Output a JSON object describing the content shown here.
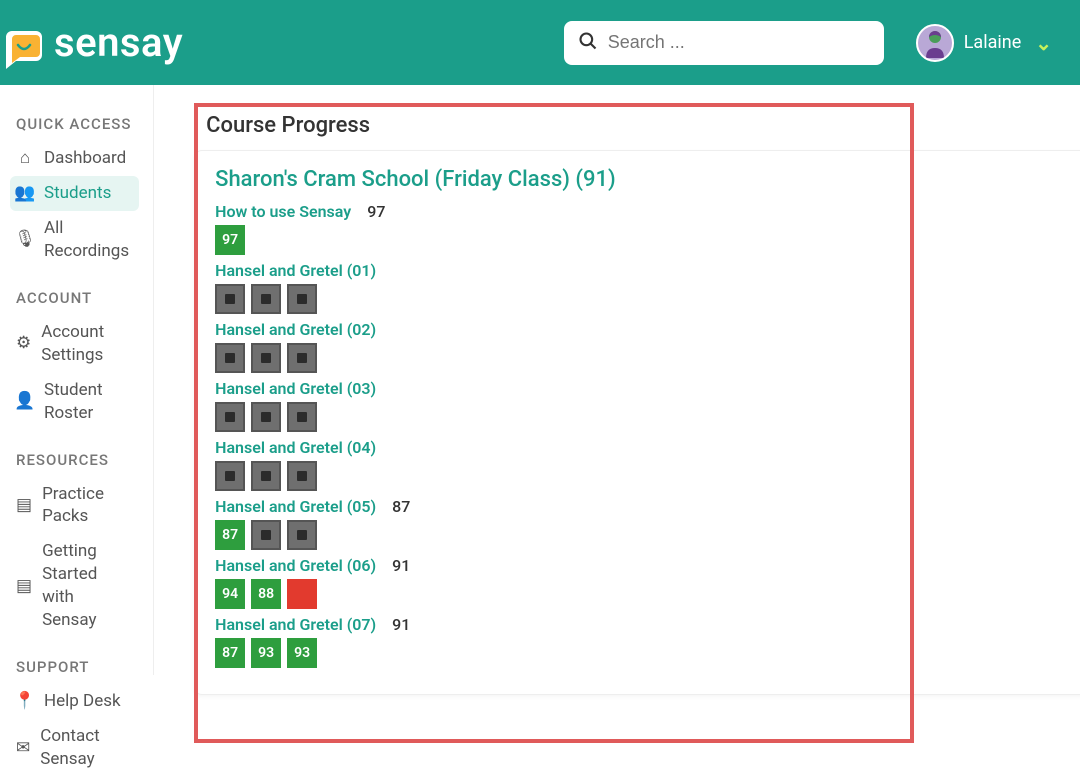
{
  "brand": {
    "name": "sensay"
  },
  "search": {
    "placeholder": "Search ..."
  },
  "user": {
    "name": "Lalaine"
  },
  "sidebar": {
    "sections": [
      {
        "title": "QUICK ACCESS",
        "items": [
          {
            "icon": "home",
            "label": "Dashboard",
            "name": "dashboard",
            "active": false
          },
          {
            "icon": "users",
            "label": "Students",
            "name": "students",
            "active": true
          },
          {
            "icon": "mic",
            "label": "All Recordings",
            "name": "all-recordings",
            "active": false
          }
        ]
      },
      {
        "title": "ACCOUNT",
        "items": [
          {
            "icon": "gear",
            "label": "Account Settings",
            "name": "account-settings"
          },
          {
            "icon": "roster",
            "label": "Student Roster",
            "name": "student-roster"
          }
        ]
      },
      {
        "title": "RESOURCES",
        "items": [
          {
            "icon": "book",
            "label": "Practice Packs",
            "name": "practice-packs"
          },
          {
            "icon": "book",
            "label": "Getting Started with Sensay",
            "name": "getting-started"
          }
        ]
      },
      {
        "title": "SUPPORT",
        "items": [
          {
            "icon": "pin",
            "label": "Help Desk",
            "name": "help-desk"
          },
          {
            "icon": "mail",
            "label": "Contact Sensay",
            "name": "contact-sensay"
          }
        ]
      }
    ]
  },
  "main": {
    "panel_title": "Course Progress",
    "class_title": "Sharon's Cram School (Friday Class) (91)",
    "lessons": [
      {
        "title": "How to use Sensay",
        "score": "97",
        "tiles": [
          {
            "kind": "green",
            "val": "97"
          }
        ]
      },
      {
        "title": "Hansel and Gretel (01)",
        "score": "",
        "tiles": [
          {
            "kind": "grey"
          },
          {
            "kind": "grey"
          },
          {
            "kind": "grey"
          }
        ]
      },
      {
        "title": "Hansel and Gretel (02)",
        "score": "",
        "tiles": [
          {
            "kind": "grey"
          },
          {
            "kind": "grey"
          },
          {
            "kind": "grey"
          }
        ]
      },
      {
        "title": "Hansel and Gretel (03)",
        "score": "",
        "tiles": [
          {
            "kind": "grey"
          },
          {
            "kind": "grey"
          },
          {
            "kind": "grey"
          }
        ]
      },
      {
        "title": "Hansel and Gretel (04)",
        "score": "",
        "tiles": [
          {
            "kind": "grey"
          },
          {
            "kind": "grey"
          },
          {
            "kind": "grey"
          }
        ]
      },
      {
        "title": "Hansel and Gretel (05)",
        "score": "87",
        "tiles": [
          {
            "kind": "green",
            "val": "87"
          },
          {
            "kind": "grey"
          },
          {
            "kind": "grey"
          }
        ]
      },
      {
        "title": "Hansel and Gretel (06)",
        "score": "91",
        "tiles": [
          {
            "kind": "green",
            "val": "94"
          },
          {
            "kind": "green",
            "val": "88"
          },
          {
            "kind": "red"
          }
        ]
      },
      {
        "title": "Hansel and Gretel (07)",
        "score": "91",
        "tiles": [
          {
            "kind": "green",
            "val": "87"
          },
          {
            "kind": "green",
            "val": "93"
          },
          {
            "kind": "green",
            "val": "93"
          }
        ]
      }
    ]
  }
}
